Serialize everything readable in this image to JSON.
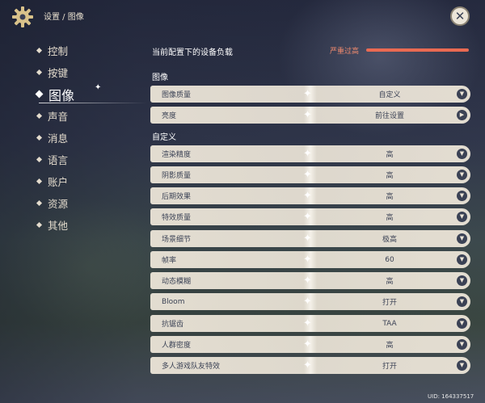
{
  "header": {
    "breadcrumb": "设置 / 图像",
    "close_icon": "close-icon"
  },
  "sidebar": {
    "items": [
      {
        "label": "控制",
        "active": false
      },
      {
        "label": "按键",
        "active": false
      },
      {
        "label": "图像",
        "active": true
      },
      {
        "label": "声音",
        "active": false
      },
      {
        "label": "消息",
        "active": false
      },
      {
        "label": "语言",
        "active": false
      },
      {
        "label": "账户",
        "active": false
      },
      {
        "label": "资源",
        "active": false
      },
      {
        "label": "其他",
        "active": false
      }
    ]
  },
  "load": {
    "title": "当前配置下的设备负载",
    "status": "严重过高",
    "level": 1.0,
    "color": "#ea6a52"
  },
  "sections": {
    "graphics": "图像",
    "custom": "自定义"
  },
  "graphics_rows": [
    {
      "label": "图像质量",
      "value": "自定义",
      "control": "dropdown"
    },
    {
      "label": "亮度",
      "value": "前往设置",
      "control": "link"
    }
  ],
  "custom_rows": [
    {
      "label": "渲染精度",
      "value": "高"
    },
    {
      "label": "阴影质量",
      "value": "高"
    },
    {
      "label": "后期效果",
      "value": "高"
    },
    {
      "label": "特效质量",
      "value": "高"
    },
    {
      "label": "场景细节",
      "value": "极高"
    },
    {
      "label": "帧率",
      "value": "60"
    },
    {
      "label": "动态模糊",
      "value": "高"
    },
    {
      "label": "Bloom",
      "value": "打开"
    },
    {
      "label": "抗锯齿",
      "value": "TAA"
    },
    {
      "label": "人群密度",
      "value": "高"
    },
    {
      "label": "多人游戏队友特效",
      "value": "打开"
    }
  ],
  "footer": {
    "uid": "UID: 164337517"
  },
  "colors": {
    "row_background": "#ece5d8",
    "row_text": "#3b4255",
    "warning": "#f08a6e"
  }
}
